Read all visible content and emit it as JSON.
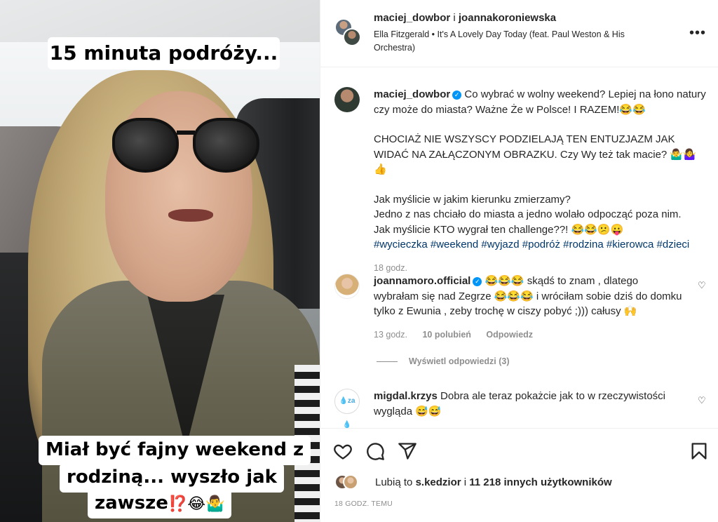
{
  "media": {
    "caption_top": "15 minuta podróży...",
    "caption_bottom_line1": "Miał być fajny weekend z",
    "caption_bottom_line2": "rodziną... wyszło jak",
    "caption_bottom_line3": "zawsze",
    "caption_bottom_emoji": "⁉️😂🤷‍♂️"
  },
  "header": {
    "user1": "maciej_dowbor",
    "separator": "i",
    "user2": "joannakoroniewska",
    "music": "Ella Fitzgerald • It's A Lovely Day Today (feat. Paul Weston & His Orchestra)",
    "more_icon": "•••"
  },
  "caption_post": {
    "username": "maciej_dowbor",
    "verified_mark": "✓",
    "p1": "Co wybrać w wolny weekend? Lepiej na łono natury czy może do miasta? Ważne Że w Polsce! I RAZEM!😂😂",
    "p2": "CHOCIAŻ NIE WSZYSCY PODZIELAJĄ TEN ENTUZJAZM JAK WIDAĆ NA ZAŁĄCZONYM OBRAZKU. Czy Wy też tak macie? 🤷‍♂️🤷‍♀️👍",
    "p3a": "Jak myślicie w jakim kierunku zmierzamy?",
    "p3b": "Jedno z nas chciało do miasta a jedno wolało odpocząć poza nim.",
    "p3c": "Jak myślicie KTO wygrał ten challenge??! 😂😂😕😛",
    "tags": "#wycieczka #weekend #wyjazd #podróż #rodzina #kierowca #dzieci",
    "time": "18 godz."
  },
  "comments": [
    {
      "username": "joannamoro.official",
      "verified_mark": "✓",
      "text": "😂😂😂 skądś to znam , dlatego wybrałam się nad Zegrze 😂😂😂 i wróciłam sobie dziś do domku tylko z Ewunia , zeby trochę w ciszy pobyć ;))) całusy 🙌",
      "time": "13 godz.",
      "likes": "10 polubień",
      "reply": "Odpowiedz",
      "view_replies": "Wyświetl odpowiedzi (3)"
    },
    {
      "username": "migdal.krzys",
      "text": "Dobra ale teraz pokażcie jak to w rzeczywistości wygląda 😅😅",
      "avatar_text": "💧za💧"
    }
  ],
  "likes": {
    "prefix": "Lubią to",
    "user": "s.kedzior",
    "mid": "i",
    "count": "11 218 innych użytkowników"
  },
  "time_ago": "18 GODZ. TEMU",
  "icons": {
    "like": "heart-icon",
    "comment": "comment-icon",
    "share": "paper-plane-icon",
    "save": "bookmark-icon",
    "more": "more-dots-icon"
  },
  "colors": {
    "verified": "#0095f6",
    "tags": "#00376b",
    "muted": "#8e8e8e",
    "text": "#262626"
  }
}
